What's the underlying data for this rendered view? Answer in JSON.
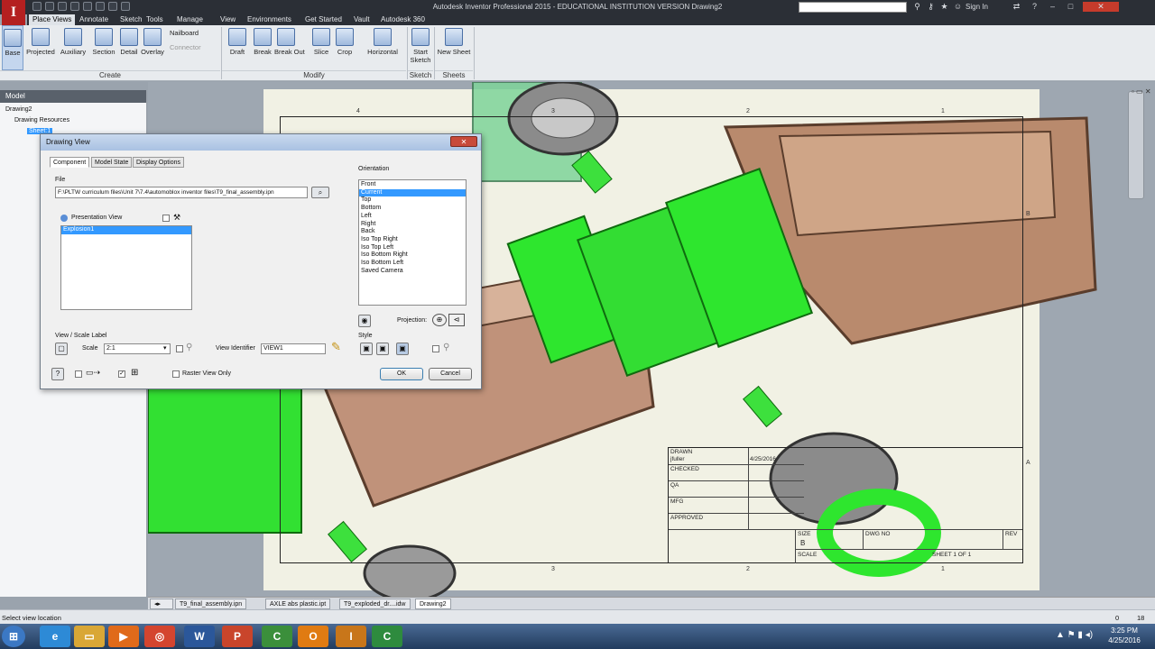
{
  "app": {
    "title": "Autodesk Inventor Professional 2015 - EDUCATIONAL INSTITUTION VERSION   Drawing2",
    "logo": "I",
    "sign_in": "Sign In"
  },
  "menu_tabs": [
    "Place Views",
    "Annotate",
    "Sketch",
    "Tools",
    "Manage",
    "View",
    "Environments",
    "Get Started",
    "Vault",
    "Autodesk 360"
  ],
  "ribbon": {
    "create_buttons": [
      "Base",
      "Projected",
      "Auxiliary",
      "Section",
      "Detail",
      "Overlay"
    ],
    "nailboard": "Nailboard",
    "connector": "Connector",
    "create_panel": "Create",
    "modify_buttons": [
      "Draft",
      "Break",
      "Break Out",
      "Slice",
      "Crop",
      "Horizontal"
    ],
    "modify_panel": "Modify",
    "sketch_button": "Start Sketch",
    "sketch_panel": "Sketch",
    "sheets_button": "New Sheet",
    "sheets_panel": "Sheets"
  },
  "browser": {
    "header": "Model",
    "items": [
      "Drawing2",
      "Drawing Resources",
      "Sheet:1"
    ]
  },
  "dialog": {
    "title": "Drawing View",
    "close": "✕",
    "tabs": [
      "Component",
      "Model State",
      "Display Options"
    ],
    "file_label": "File",
    "file_path": "F:\\PLTW curriculum files\\Unit 7\\7.4\\automoblox inventor files\\T9_final_assembly.ipn",
    "presentation_label": "Presentation View",
    "presentation_items": [
      "Explosion1"
    ],
    "orientation_label": "Orientation",
    "orientation_options": [
      "Front",
      "Current",
      "Top",
      "Bottom",
      "Left",
      "Right",
      "Back",
      "Iso Top Right",
      "Iso Top Left",
      "Iso Bottom Right",
      "Iso Bottom Left",
      "Saved Camera"
    ],
    "orientation_selected": "Current",
    "projection_label": "Projection:",
    "view_scale_label": "View / Scale Label",
    "scale_label": "Scale",
    "scale_value": "2:1",
    "view_identifier_label": "View Identifier",
    "view_identifier_value": "VIEW1",
    "style_label": "Style",
    "raster_label": "Raster View Only",
    "ok": "OK",
    "cancel": "Cancel"
  },
  "drawing": {
    "zones_top": [
      "4",
      "3",
      "2",
      "1"
    ],
    "zones_side": [
      "B",
      "A"
    ],
    "title_block": {
      "drawn": "DRAWN",
      "drawn_by": "jfuller",
      "drawn_date": "4/25/2016",
      "checked": "CHECKED",
      "qa": "QA",
      "mfg": "MFG",
      "approved": "APPROVED",
      "size": "SIZE",
      "size_value": "B",
      "dwg_no": "DWG NO",
      "rev": "REV",
      "scale": "SCALE",
      "sheet": "SHEET 1  OF 1"
    }
  },
  "doc_tabs": [
    "T9_final_assembly.ipn",
    "AXLE abs plastic.ipt",
    "T9_exploded_dr....idw",
    "Drawing2"
  ],
  "doc_tab_active": "Drawing2",
  "status": {
    "text": "Select view location",
    "right_a": "0",
    "right_b": "18"
  },
  "taskbar": {
    "time": "3:25 PM",
    "date": "4/25/2016",
    "apps": [
      {
        "icon": "start-orb-icon",
        "glyph": "⊞",
        "color": "#3b78c4"
      },
      {
        "icon": "internet-explorer-icon",
        "glyph": "e",
        "color": "#2d8ad6"
      },
      {
        "icon": "folder-icon",
        "glyph": "▭",
        "color": "#d9a736"
      },
      {
        "icon": "media-player-icon",
        "glyph": "▶",
        "color": "#e06a1a"
      },
      {
        "icon": "chrome-icon",
        "glyph": "◎",
        "color": "#d4452f"
      },
      {
        "icon": "word-icon",
        "glyph": "W",
        "color": "#2b579a"
      },
      {
        "icon": "powerpoint-icon",
        "glyph": "P",
        "color": "#c9452b"
      },
      {
        "icon": "camtasia-icon",
        "glyph": "C",
        "color": "#3b8f3b"
      },
      {
        "icon": "outlook-icon",
        "glyph": "O",
        "color": "#e07b12"
      },
      {
        "icon": "inventor-icon",
        "glyph": "I",
        "color": "#c8761a"
      },
      {
        "icon": "camtasia-recorder-icon",
        "glyph": "C",
        "color": "#2e8b3e"
      }
    ]
  }
}
